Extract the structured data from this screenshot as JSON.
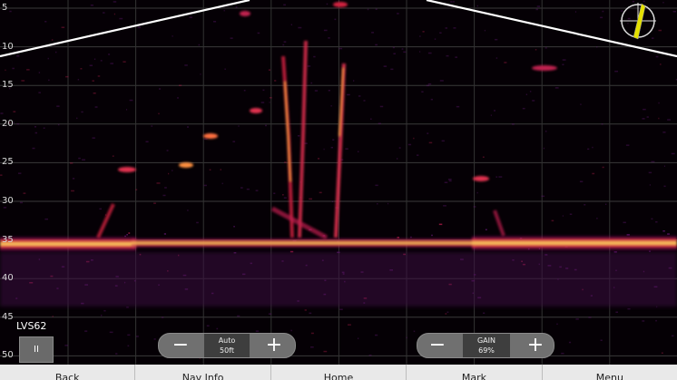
{
  "sonar": {
    "mode_label": "LVS62",
    "depth_scale": [
      "5",
      "10",
      "15",
      "20",
      "25",
      "30",
      "35",
      "40",
      "45",
      "50"
    ]
  },
  "range_control": {
    "minus": "−",
    "plus": "+",
    "mode": "Auto",
    "value": "50ft"
  },
  "gain_control": {
    "minus": "−",
    "plus": "+",
    "label": "GAIN",
    "value": "69%"
  },
  "pause": {
    "label": "II"
  },
  "menu": {
    "items": [
      "Back",
      "Nav Info",
      "Home",
      "Mark",
      "Menu"
    ]
  },
  "colors": {
    "bottom_return": "#ffd23a",
    "return_mid": "#e0203a",
    "return_low": "#7a1a8a",
    "compass_needle": "#e4e000"
  },
  "icons": {
    "compass": "compass-icon",
    "pause": "pause-icon"
  }
}
